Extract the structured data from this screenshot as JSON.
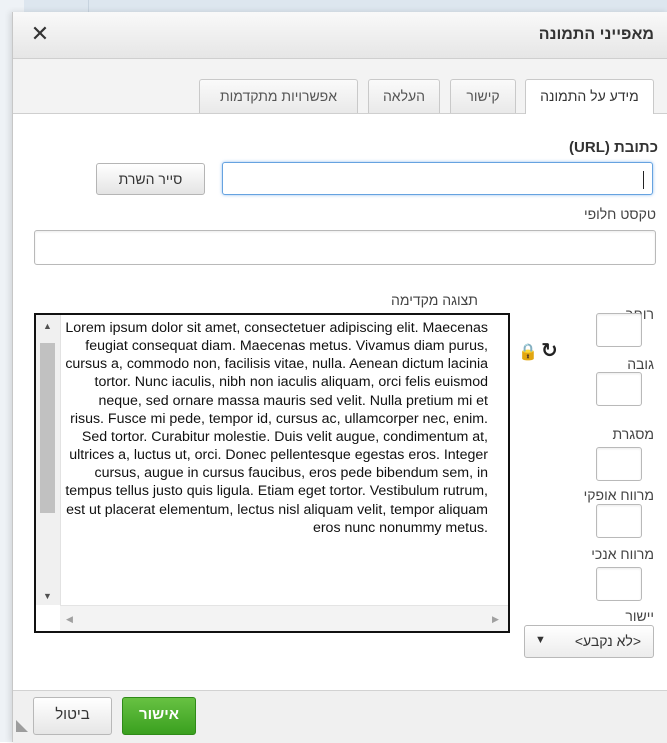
{
  "dialog": {
    "title": "מאפייני התמונה",
    "close_glyph": "✕"
  },
  "tabs": [
    {
      "label": "מידע על התמונה",
      "active": true
    },
    {
      "label": "קישור",
      "active": false
    },
    {
      "label": "העלאה",
      "active": false
    },
    {
      "label": "אפשרויות מתקדמות",
      "active": false
    }
  ],
  "url": {
    "label": "כתובת (URL)",
    "value": "",
    "browse_button": "סייר השרת"
  },
  "alt_text": {
    "label": "טקסט חלופי",
    "value": ""
  },
  "preview": {
    "label": "תצוגה מקדימה",
    "text": "Lorem ipsum dolor sit amet, consectetuer adipiscing elit. Maecenas feugiat consequat diam. Maecenas metus. Vivamus diam purus, cursus a, commodo non, facilisis vitae, nulla. Aenean dictum lacinia tortor. Nunc iaculis, nibh non iaculis aliquam, orci felis euismod neque, sed ornare massa mauris sed velit. Nulla pretium mi et risus. Fusce mi pede, tempor id, cursus ac, ullamcorper nec, enim. Sed tortor. Curabitur molestie. Duis velit augue, condimentum at, ultrices a, luctus ut, orci. Donec pellentesque egestas eros. Integer cursus, augue in cursus faucibus, eros pede bibendum sem, in tempus tellus justo quis ligula. Etiam eget tortor. Vestibulum rutrum, est ut placerat elementum, lectus nisl aliquam velit, tempor aliquam eros nunc nonummy metus."
  },
  "dimensions": {
    "width_label": "רוחב",
    "height_label": "גובה",
    "width_value": "",
    "height_value": "",
    "lock_glyph": "🔒",
    "reset_glyph": "↻"
  },
  "border": {
    "label": "מסגרת",
    "value": ""
  },
  "hspace": {
    "label": "מרווח אופקי",
    "value": ""
  },
  "vspace": {
    "label": "מרווח אנכי",
    "value": ""
  },
  "alignment": {
    "label": "יישור",
    "selected": "<לא נקבע>",
    "arrow_glyph": "▼"
  },
  "footer": {
    "ok_label": "אישור",
    "cancel_label": "ביטול"
  }
}
